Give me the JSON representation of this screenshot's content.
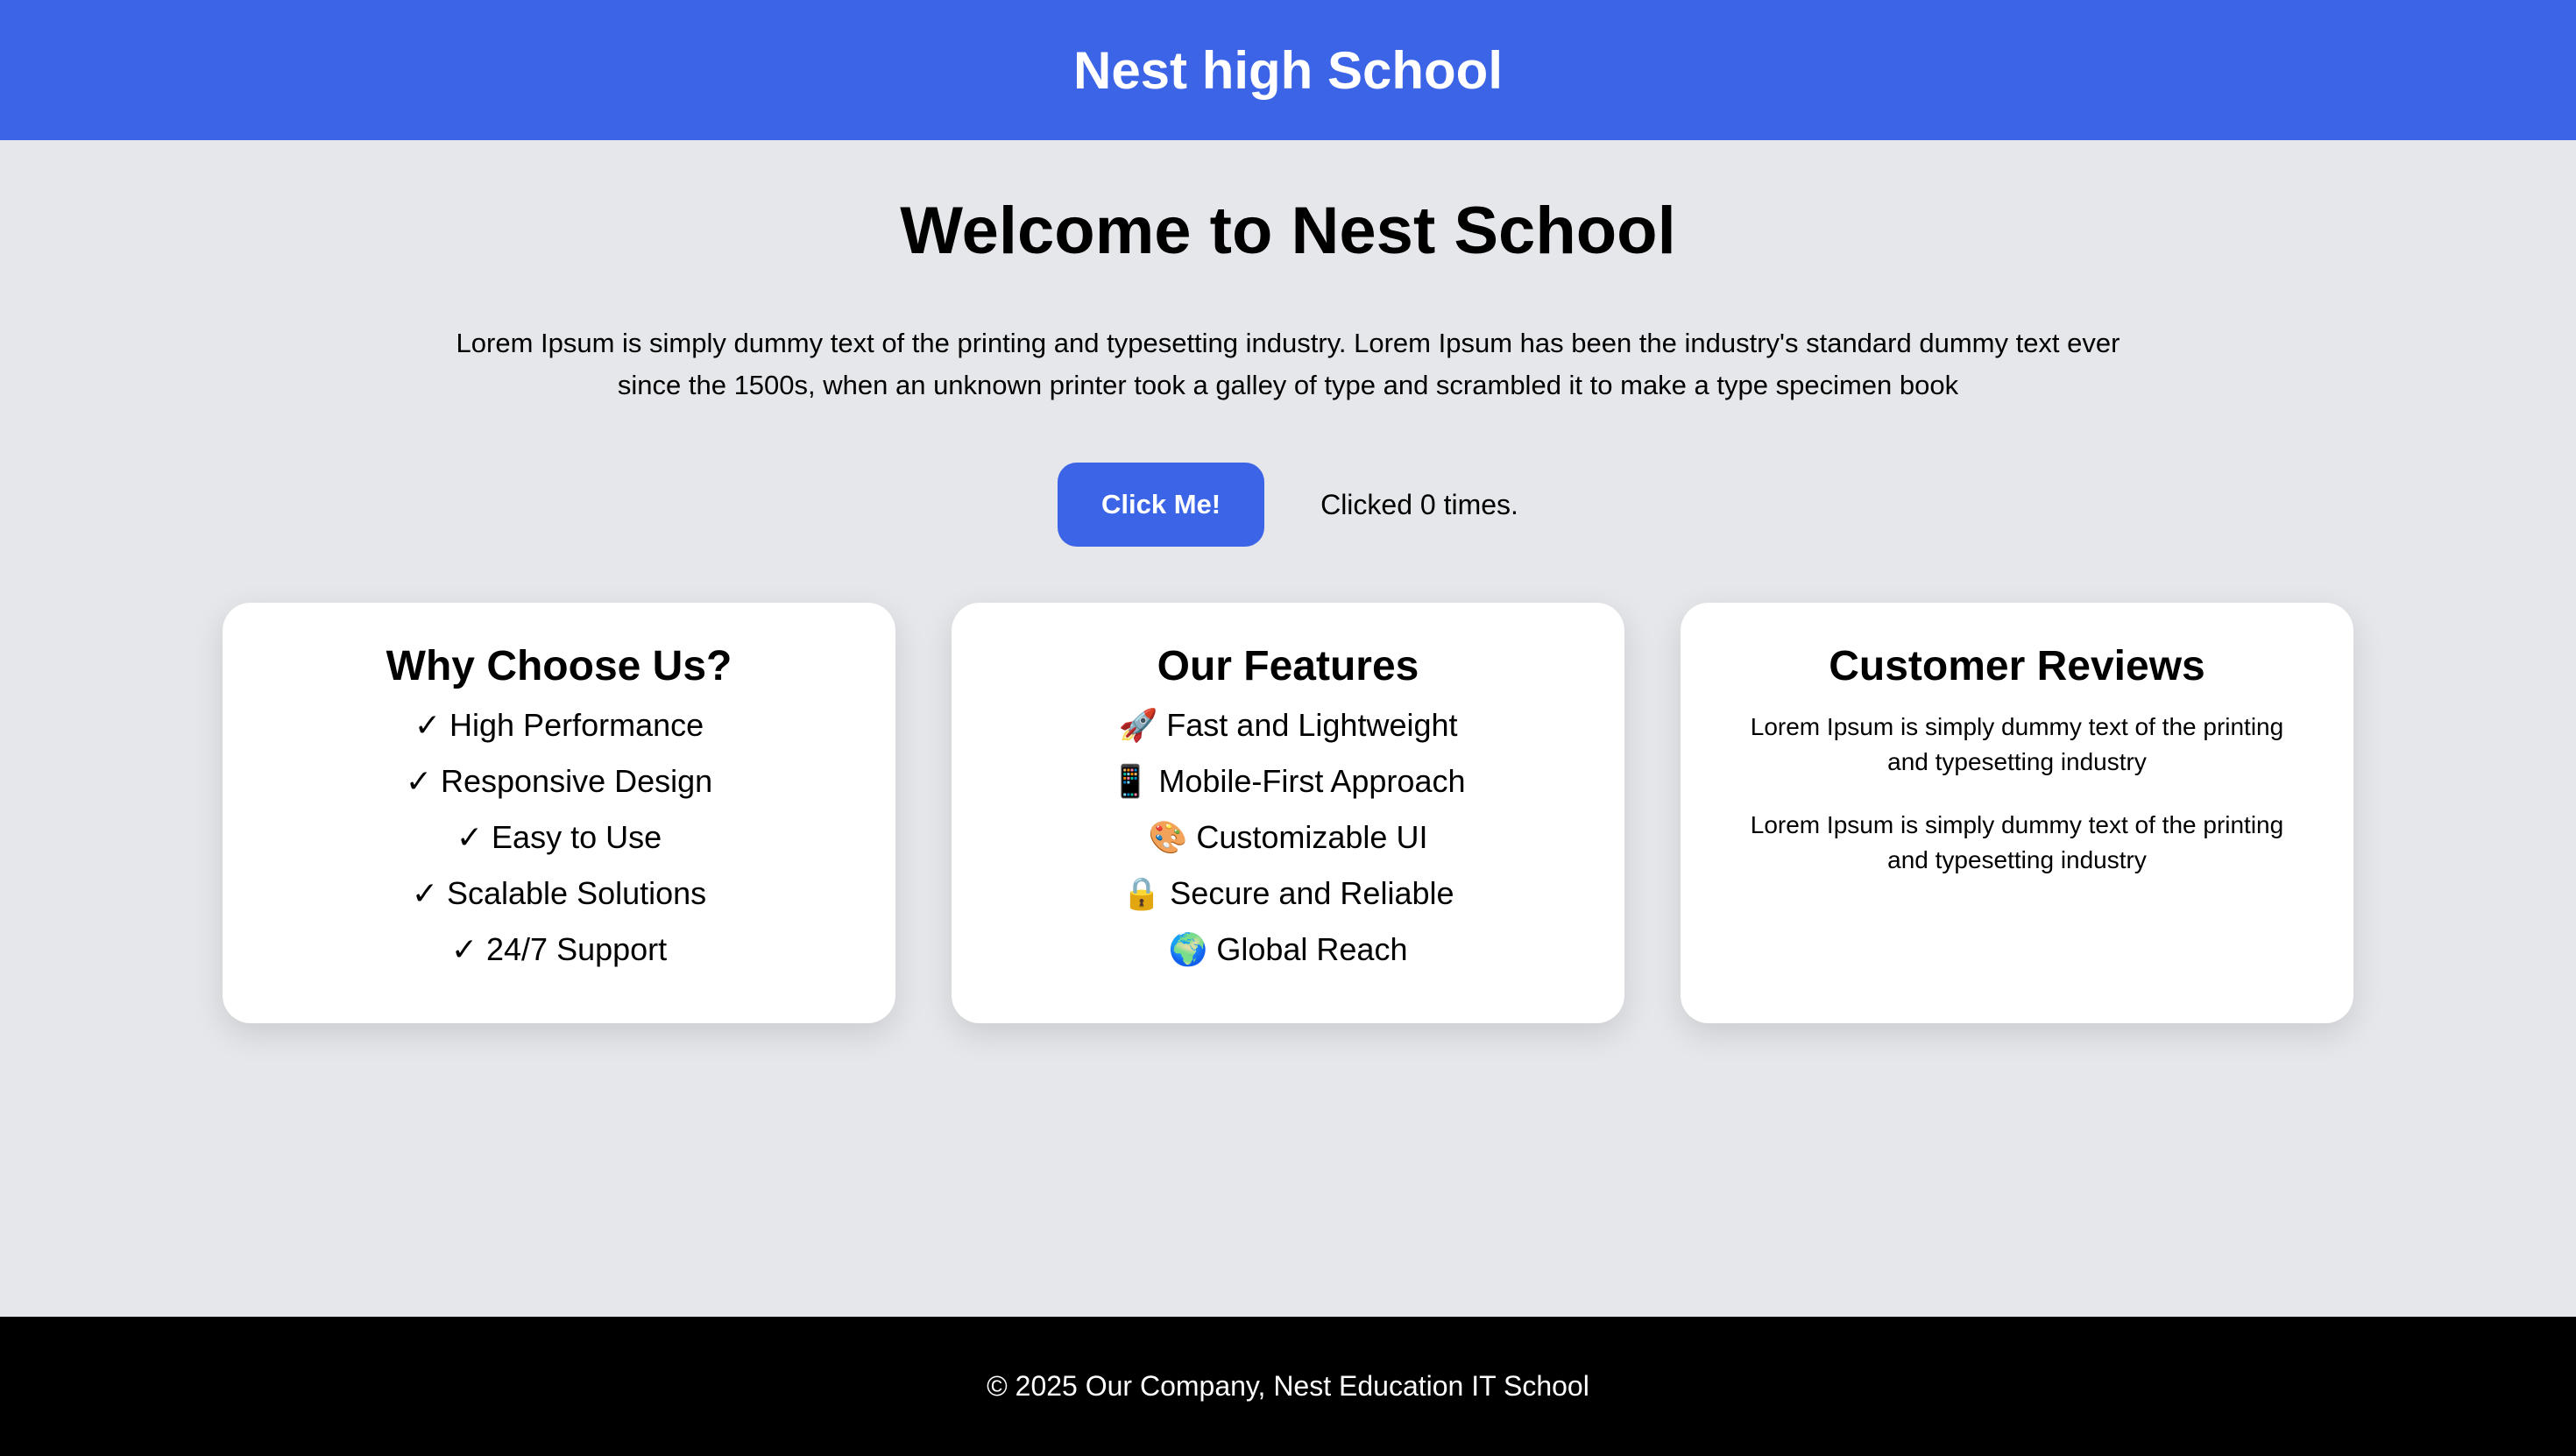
{
  "header": {
    "title": "Nest high School"
  },
  "hero": {
    "heading": "Welcome to Nest School",
    "intro": "Lorem Ipsum is simply dummy text of the printing and typesetting industry. Lorem Ipsum has been the industry's standard dummy text ever since the 1500s, when an unknown printer took a galley of type and scrambled it to make a type specimen book",
    "button_label": "Click Me!",
    "click_count_text": "Clicked 0 times."
  },
  "cards": [
    {
      "title": "Why Choose Us?",
      "items": [
        "✓ High Performance",
        "✓ Responsive Design",
        "✓ Easy to Use",
        "✓ Scalable Solutions",
        "✓ 24/7 Support"
      ]
    },
    {
      "title": "Our Features",
      "items": [
        "🚀 Fast and Lightweight",
        "📱 Mobile-First Approach",
        "🎨 Customizable UI",
        "🔒 Secure and Reliable",
        "🌍 Global Reach"
      ]
    },
    {
      "title": "Customer Reviews",
      "reviews": [
        "Lorem Ipsum is simply dummy text of the printing and typesetting industry",
        "Lorem Ipsum is simply dummy text of the printing and typesetting industry"
      ]
    }
  ],
  "footer": {
    "text": "© 2025 Our Company, Nest Education IT School"
  },
  "colors": {
    "brand": "#3b64e6",
    "page_background": "#e5e7eb",
    "card_background": "#ffffff",
    "footer_background": "#000000"
  }
}
